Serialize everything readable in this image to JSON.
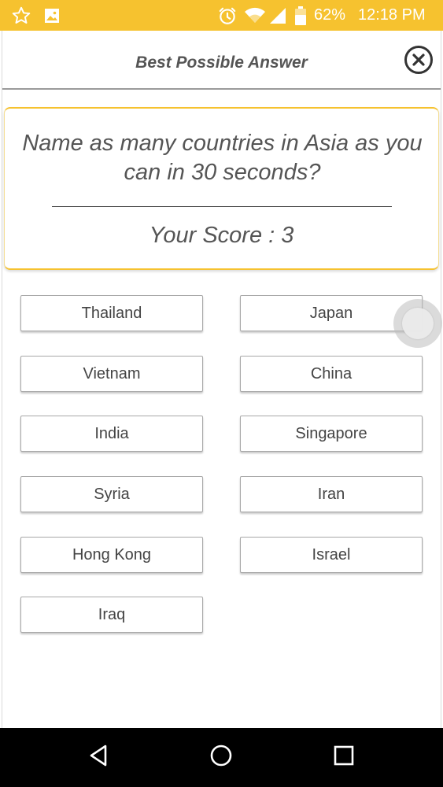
{
  "status_bar": {
    "battery_percent": "62%",
    "time": "12:18 PM",
    "background_color": "#f6c22f",
    "icons": [
      "star-icon",
      "image-icon",
      "alarm-icon",
      "wifi-icon",
      "signal-icon",
      "battery-icon"
    ]
  },
  "header": {
    "title": "Best Possible Answer",
    "close_icon": "close-circle-icon"
  },
  "question_card": {
    "question": "Name as many countries in Asia as you can in 30 seconds?",
    "score_label": "Your Score : 3"
  },
  "answers": [
    "Thailand",
    "Japan",
    "Vietnam",
    "China",
    "India",
    "Singapore",
    "Syria",
    "Iran",
    "Hong Kong",
    "Israel",
    "Iraq"
  ],
  "nav_bar": {
    "icons": [
      "back-icon",
      "home-icon",
      "recents-icon"
    ]
  },
  "colors": {
    "accent": "#f6c22f",
    "text": "#555555"
  }
}
